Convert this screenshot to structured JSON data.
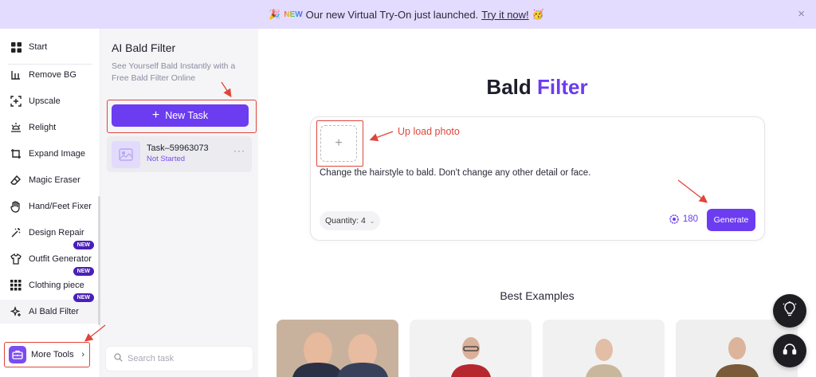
{
  "banner": {
    "new_label": "NEW",
    "text": "Our new Virtual Try-On just launched.",
    "link": "Try it now!",
    "close": "×"
  },
  "nav": {
    "items": [
      {
        "label": "Start",
        "icon": "grid-icon"
      },
      {
        "label": "Remove BG",
        "icon": "remove-bg-icon"
      },
      {
        "label": "Upscale",
        "icon": "upscale-icon"
      },
      {
        "label": "Relight",
        "icon": "relight-icon"
      },
      {
        "label": "Expand Image",
        "icon": "expand-icon"
      },
      {
        "label": "Magic Eraser",
        "icon": "eraser-icon"
      },
      {
        "label": "Hand/Feet Fixer",
        "icon": "hand-icon"
      },
      {
        "label": "Design Repair",
        "icon": "wand-icon"
      },
      {
        "label": "Outfit Generator",
        "icon": "shirt-icon",
        "badge": "NEW"
      },
      {
        "label": "Clothing piece",
        "icon": "pieces-icon",
        "badge": "NEW"
      },
      {
        "label": "AI Bald Filter",
        "icon": "sparkle-icon",
        "badge": "NEW"
      }
    ],
    "more_tools": "More Tools"
  },
  "panel": {
    "title": "AI Bald Filter",
    "description": "See Yourself Bald Instantly with a Free Bald Filter Online",
    "new_task": "New Task",
    "task": {
      "name": "Task–59963073",
      "status": "Not Started"
    },
    "search_placeholder": "Search task"
  },
  "main": {
    "title_plain": "Bald",
    "title_accent": "Filter",
    "upload_note": "Up load photo",
    "prompt": "Change the hairstyle to bald. Don't change any other detail or face.",
    "quantity": "Quantity: 4",
    "credits": "180",
    "generate": "Generate",
    "best_examples": "Best Examples"
  },
  "colors": {
    "accent": "#6c3cf0",
    "annotation": "#e0453a",
    "banner_bg": "#e4dcff"
  }
}
